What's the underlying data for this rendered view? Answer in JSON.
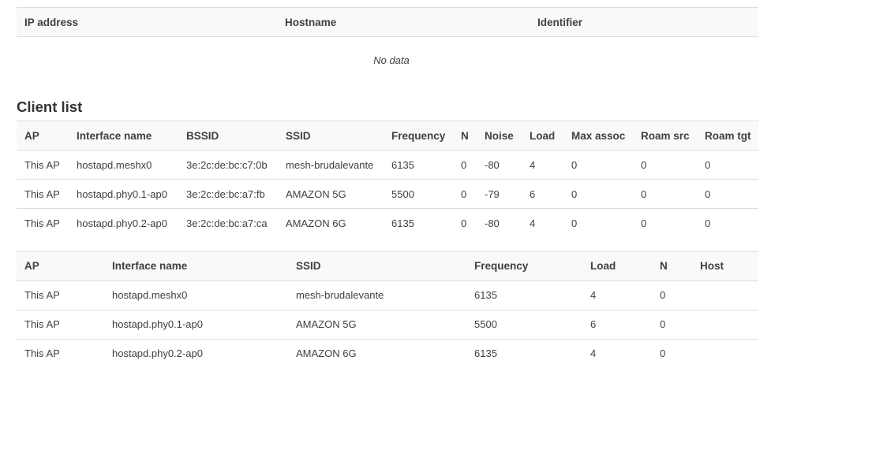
{
  "hosts_table": {
    "headers": [
      "IP address",
      "Hostname",
      "Identifier"
    ],
    "empty_text": "No data"
  },
  "client_list": {
    "title": "Client list",
    "headers": [
      "AP",
      "Interface name",
      "BSSID",
      "SSID",
      "Frequency",
      "N",
      "Noise",
      "Load",
      "Max assoc",
      "Roam src",
      "Roam tgt"
    ],
    "rows": [
      [
        "This AP",
        "hostapd.meshx0",
        "3e:2c:de:bc:c7:0b",
        "mesh-brudalevante",
        "6135",
        "0",
        "-80",
        "4",
        "0",
        "0",
        "0"
      ],
      [
        "This AP",
        "hostapd.phy0.1-ap0",
        "3e:2c:de:bc:a7:fb",
        "AMAZON 5G",
        "5500",
        "0",
        "-79",
        "6",
        "0",
        "0",
        "0"
      ],
      [
        "This AP",
        "hostapd.phy0.2-ap0",
        "3e:2c:de:bc:a7:ca",
        "AMAZON 6G",
        "6135",
        "0",
        "-80",
        "4",
        "0",
        "0",
        "0"
      ]
    ]
  },
  "ap_table": {
    "headers": [
      "AP",
      "Interface name",
      "SSID",
      "Frequency",
      "Load",
      "N",
      "Host"
    ],
    "rows": [
      [
        "This AP",
        "hostapd.meshx0",
        "mesh-brudalevante",
        "6135",
        "4",
        "0",
        ""
      ],
      [
        "This AP",
        "hostapd.phy0.1-ap0",
        "AMAZON 5G",
        "5500",
        "6",
        "0",
        ""
      ],
      [
        "This AP",
        "hostapd.phy0.2-ap0",
        "AMAZON 6G",
        "6135",
        "4",
        "0",
        ""
      ]
    ]
  }
}
